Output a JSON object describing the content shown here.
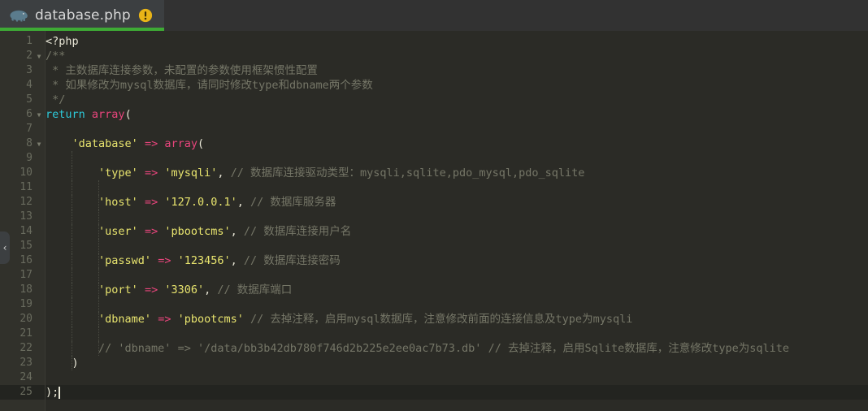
{
  "window": {
    "background_color": "#2b2b26",
    "gutter_color": "#31312b"
  },
  "tabbar": {
    "background_color": "#323232",
    "active_tab": {
      "filename": "database.php",
      "background_color": "#3c3f41",
      "underline_color": "#3eaa35",
      "file_icon": "php-elephant-icon",
      "status_icon": "warning-exclamation-icon",
      "status_icon_color": "#e8b417"
    }
  },
  "sidebar_toggle": {
    "label": "‹",
    "icon": "chevron-left-icon"
  },
  "editor": {
    "language": "php",
    "current_line": 25,
    "caret_line": 25,
    "caret_column": 3,
    "colors": {
      "keyword": "#2dc8d8",
      "function": "#e8457c",
      "string": "#e8e46e",
      "operator": "#e8457c",
      "comment": "#757667",
      "default": "#e8e6d6",
      "line_number": "#696b5e",
      "current_line_bg": "#232420"
    },
    "lines": [
      {
        "number": 1,
        "fold": false,
        "tokens": [
          {
            "t": "<?php",
            "c": "default"
          }
        ]
      },
      {
        "number": 2,
        "fold": true,
        "tokens": [
          {
            "t": "/**",
            "c": "comment"
          }
        ]
      },
      {
        "number": 3,
        "fold": false,
        "tokens": [
          {
            "t": " * 主数据库连接参数，未配置的参数使用框架惯性配置",
            "c": "comment"
          }
        ]
      },
      {
        "number": 4,
        "fold": false,
        "tokens": [
          {
            "t": " * 如果修改为mysql数据库，请同时修改type和dbname两个参数",
            "c": "comment"
          }
        ]
      },
      {
        "number": 5,
        "fold": false,
        "tokens": [
          {
            "t": " */",
            "c": "comment"
          }
        ]
      },
      {
        "number": 6,
        "fold": true,
        "tokens": [
          {
            "t": "return",
            "c": "keyword"
          },
          {
            "t": " ",
            "c": "default"
          },
          {
            "t": "array",
            "c": "function"
          },
          {
            "t": "(",
            "c": "default"
          }
        ]
      },
      {
        "number": 7,
        "fold": false,
        "tokens": []
      },
      {
        "number": 8,
        "fold": true,
        "tokens": [
          {
            "t": "    ",
            "c": "default"
          },
          {
            "t": "'database'",
            "c": "string"
          },
          {
            "t": " ",
            "c": "default"
          },
          {
            "t": "=>",
            "c": "operator"
          },
          {
            "t": " ",
            "c": "default"
          },
          {
            "t": "array",
            "c": "function"
          },
          {
            "t": "(",
            "c": "default"
          }
        ]
      },
      {
        "number": 9,
        "fold": false,
        "tokens": []
      },
      {
        "number": 10,
        "fold": false,
        "tokens": [
          {
            "t": "        ",
            "c": "default"
          },
          {
            "t": "'type'",
            "c": "string"
          },
          {
            "t": " ",
            "c": "default"
          },
          {
            "t": "=>",
            "c": "operator"
          },
          {
            "t": " ",
            "c": "default"
          },
          {
            "t": "'mysqli'",
            "c": "string"
          },
          {
            "t": ", ",
            "c": "default"
          },
          {
            "t": "// 数据库连接驱动类型：mysqli,sqlite,pdo_mysql,pdo_sqlite",
            "c": "comment"
          }
        ]
      },
      {
        "number": 11,
        "fold": false,
        "tokens": []
      },
      {
        "number": 12,
        "fold": false,
        "tokens": [
          {
            "t": "        ",
            "c": "default"
          },
          {
            "t": "'host'",
            "c": "string"
          },
          {
            "t": " ",
            "c": "default"
          },
          {
            "t": "=>",
            "c": "operator"
          },
          {
            "t": " ",
            "c": "default"
          },
          {
            "t": "'127.0.0.1'",
            "c": "string"
          },
          {
            "t": ", ",
            "c": "default"
          },
          {
            "t": "// 数据库服务器",
            "c": "comment"
          }
        ]
      },
      {
        "number": 13,
        "fold": false,
        "tokens": []
      },
      {
        "number": 14,
        "fold": false,
        "tokens": [
          {
            "t": "        ",
            "c": "default"
          },
          {
            "t": "'user'",
            "c": "string"
          },
          {
            "t": " ",
            "c": "default"
          },
          {
            "t": "=>",
            "c": "operator"
          },
          {
            "t": " ",
            "c": "default"
          },
          {
            "t": "'pbootcms'",
            "c": "string"
          },
          {
            "t": ", ",
            "c": "default"
          },
          {
            "t": "// 数据库连接用户名",
            "c": "comment"
          }
        ]
      },
      {
        "number": 15,
        "fold": false,
        "tokens": []
      },
      {
        "number": 16,
        "fold": false,
        "tokens": [
          {
            "t": "        ",
            "c": "default"
          },
          {
            "t": "'passwd'",
            "c": "string"
          },
          {
            "t": " ",
            "c": "default"
          },
          {
            "t": "=>",
            "c": "operator"
          },
          {
            "t": " ",
            "c": "default"
          },
          {
            "t": "'123456'",
            "c": "string"
          },
          {
            "t": ", ",
            "c": "default"
          },
          {
            "t": "// 数据库连接密码",
            "c": "comment"
          }
        ]
      },
      {
        "number": 17,
        "fold": false,
        "tokens": []
      },
      {
        "number": 18,
        "fold": false,
        "tokens": [
          {
            "t": "        ",
            "c": "default"
          },
          {
            "t": "'port'",
            "c": "string"
          },
          {
            "t": " ",
            "c": "default"
          },
          {
            "t": "=>",
            "c": "operator"
          },
          {
            "t": " ",
            "c": "default"
          },
          {
            "t": "'3306'",
            "c": "string"
          },
          {
            "t": ", ",
            "c": "default"
          },
          {
            "t": "// 数据库端口",
            "c": "comment"
          }
        ]
      },
      {
        "number": 19,
        "fold": false,
        "tokens": []
      },
      {
        "number": 20,
        "fold": false,
        "tokens": [
          {
            "t": "        ",
            "c": "default"
          },
          {
            "t": "'dbname'",
            "c": "string"
          },
          {
            "t": " ",
            "c": "default"
          },
          {
            "t": "=>",
            "c": "operator"
          },
          {
            "t": " ",
            "c": "default"
          },
          {
            "t": "'pbootcms'",
            "c": "string"
          },
          {
            "t": " ",
            "c": "default"
          },
          {
            "t": "// 去掉注释，启用mysql数据库，注意修改前面的连接信息及type为mysqli",
            "c": "comment"
          }
        ]
      },
      {
        "number": 21,
        "fold": false,
        "tokens": []
      },
      {
        "number": 22,
        "fold": false,
        "tokens": [
          {
            "t": "        ",
            "c": "default"
          },
          {
            "t": "// 'dbname' => '/data/bb3b42db780f746d2b225e2ee0ac7b73.db' // 去掉注释，启用Sqlite数据库，注意修改type为sqlite",
            "c": "comment"
          }
        ]
      },
      {
        "number": 23,
        "fold": false,
        "tokens": [
          {
            "t": "    )",
            "c": "default"
          }
        ]
      },
      {
        "number": 24,
        "fold": false,
        "tokens": []
      },
      {
        "number": 25,
        "fold": false,
        "current": true,
        "tokens": [
          {
            "t": ");",
            "c": "default"
          }
        ]
      }
    ]
  }
}
